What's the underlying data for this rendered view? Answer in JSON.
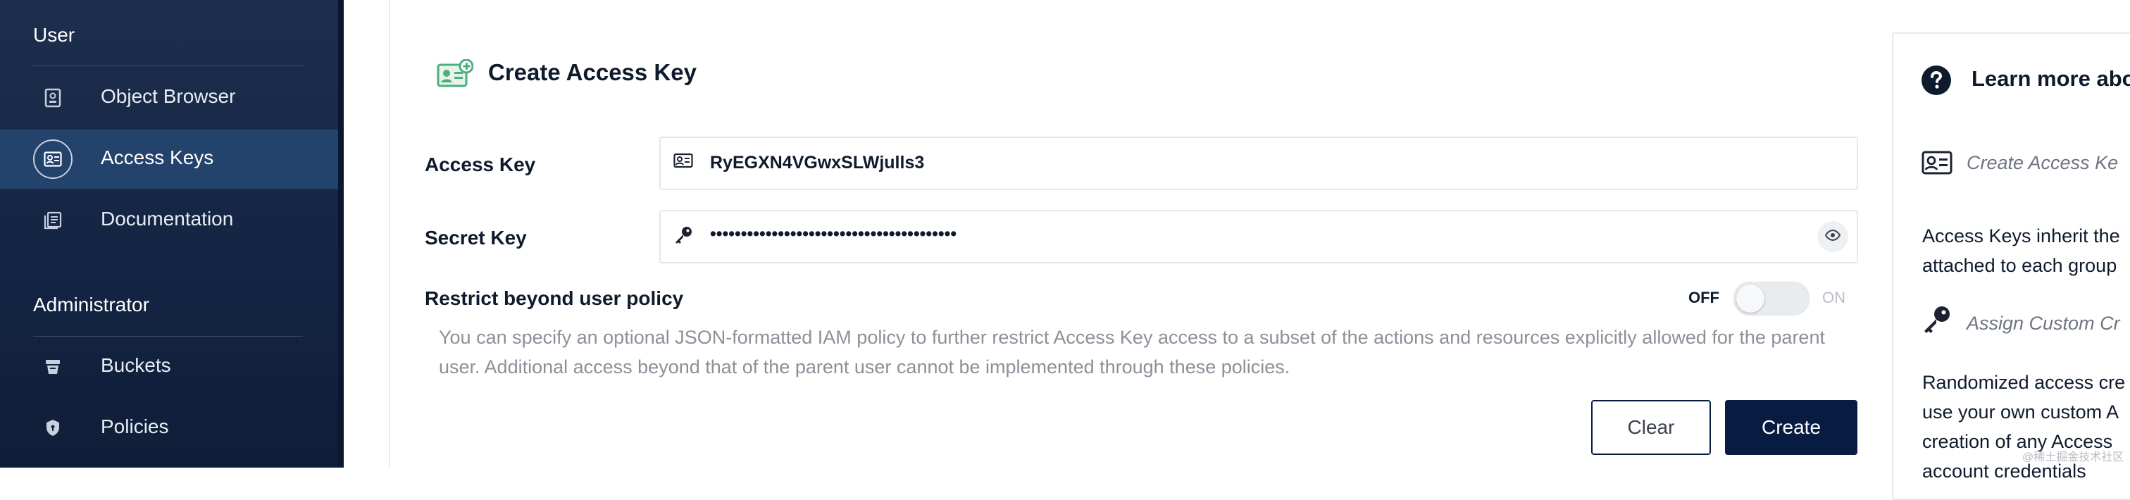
{
  "sidebar": {
    "sections": [
      {
        "title": "User",
        "items": [
          {
            "label": "Object Browser",
            "icon": "object-browser-icon",
            "active": false
          },
          {
            "label": "Access Keys",
            "icon": "access-keys-icon",
            "active": true
          },
          {
            "label": "Documentation",
            "icon": "documentation-icon",
            "active": false
          }
        ]
      },
      {
        "title": "Administrator",
        "items": [
          {
            "label": "Buckets",
            "icon": "buckets-icon",
            "active": false
          },
          {
            "label": "Policies",
            "icon": "policies-icon",
            "active": false
          }
        ]
      }
    ]
  },
  "page": {
    "title": "Create Access Key",
    "title_icon": "create-access-key-icon"
  },
  "form": {
    "access_key": {
      "label": "Access Key",
      "value": "RyEGXN4VGwxSLWjulls3",
      "icon": "id-card-icon"
    },
    "secret_key": {
      "label": "Secret Key",
      "value": "••••••••••••••••••••••••••••••••••••••••",
      "icon": "key-icon",
      "toggle_icon": "eye-icon"
    },
    "restrict": {
      "label": "Restrict beyond user policy",
      "off_label": "OFF",
      "on_label": "ON",
      "enabled": false,
      "description": "You can specify an optional JSON-formatted IAM policy to further restrict Access Key access to a subset of the actions and resources explicitly allowed for the parent user. Additional access beyond that of the parent user cannot be implemented through these policies."
    },
    "buttons": {
      "clear": "Clear",
      "create": "Create"
    }
  },
  "help": {
    "title": "Learn more abo",
    "rows": [
      {
        "icon": "id-card-icon",
        "text": "Create Access Ke"
      },
      {
        "icon": "key-icon",
        "text": "Assign Custom Cr"
      }
    ],
    "para1": [
      "Access Keys inherit the",
      "attached to each group"
    ],
    "para2": [
      "Randomized access cre",
      "use your own custom A",
      "creation of any Access",
      "account credentials"
    ]
  },
  "watermark": "@稀土掘金技术社区",
  "colors": {
    "sidebar_bg": "#142544",
    "sidebar_active": "#23426c",
    "primary_button": "#081c42",
    "title_icon_green": "#4caf7d"
  }
}
